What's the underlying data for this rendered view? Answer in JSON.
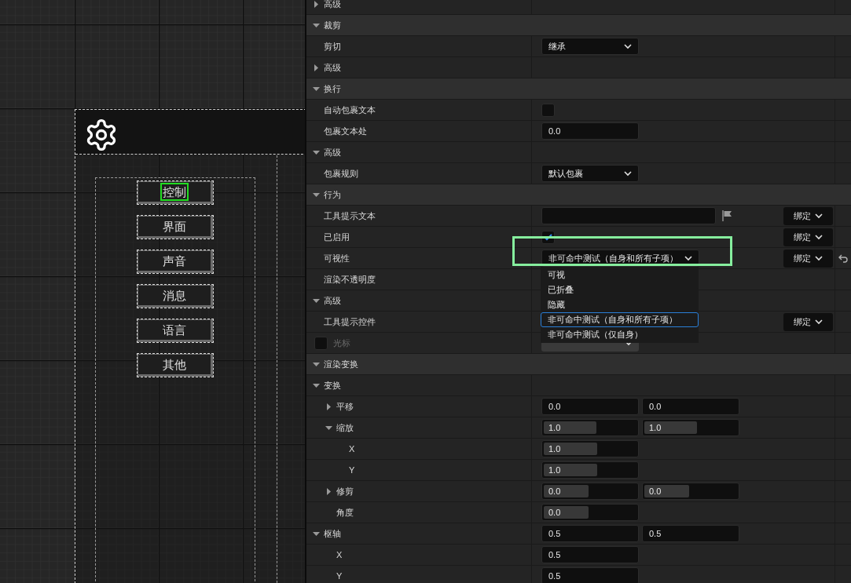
{
  "canvas": {
    "buttons": [
      {
        "label": "控制",
        "selected": true
      },
      {
        "label": "界面",
        "selected": false
      },
      {
        "label": "声音",
        "selected": false
      },
      {
        "label": "消息",
        "selected": false
      },
      {
        "label": "语言",
        "selected": false
      },
      {
        "label": "其他",
        "selected": false
      }
    ]
  },
  "details": [
    {
      "kind": "advanced",
      "label": "高级",
      "expanded": false
    },
    {
      "kind": "category",
      "label": "裁剪",
      "expanded": true,
      "children": [
        {
          "kind": "property",
          "label": "剪切",
          "value": {
            "kind": "dropdown",
            "text": "继承"
          }
        },
        {
          "kind": "advanced",
          "label": "高级",
          "expanded": false
        }
      ]
    },
    {
      "kind": "category",
      "label": "换行",
      "expanded": true,
      "children": [
        {
          "kind": "property",
          "label": "自动包裹文本",
          "value": {
            "kind": "checkbox",
            "checked": false
          }
        },
        {
          "kind": "property",
          "label": "包裹文本处",
          "value": {
            "kind": "number",
            "text": "0.0"
          }
        },
        {
          "kind": "advanced",
          "label": "高级",
          "expanded": true,
          "children": [
            {
              "kind": "property",
              "label": "包裹规则",
              "value": {
                "kind": "dropdown",
                "text": "默认包裹"
              }
            }
          ]
        }
      ]
    },
    {
      "kind": "category",
      "label": "行为",
      "expanded": true,
      "children": [
        {
          "kind": "property",
          "label": "工具提示文本",
          "value": {
            "kind": "text"
          },
          "binding": "绑定"
        },
        {
          "kind": "property",
          "label": "已启用",
          "value": {
            "kind": "checkbox",
            "checked": true
          },
          "binding": "绑定"
        },
        {
          "kind": "property",
          "label": "可视性",
          "value": {
            "kind": "dropdown",
            "text": "非可命中测试（自身和所有子项）",
            "open": true,
            "options": [
              {
                "label": "可视",
                "selected": false
              },
              {
                "label": "已折叠",
                "selected": false
              },
              {
                "label": "隐藏",
                "selected": false
              },
              {
                "label": "非可命中测试（自身和所有子项）",
                "selected": true
              },
              {
                "label": "非可命中测试（仅自身）",
                "selected": false
              }
            ]
          },
          "binding": "绑定",
          "reset": true
        },
        {
          "kind": "property",
          "label": "渲染不透明度"
        },
        {
          "kind": "advanced",
          "label": "高级",
          "expanded": true,
          "children": [
            {
              "kind": "property",
              "label": "工具提示控件",
              "binding": "绑定"
            },
            {
              "kind": "property",
              "label": "光标",
              "disabled": true,
              "edit_condition": {
                "checked": false
              },
              "value": {
                "kind": "dropdown"
              }
            }
          ]
        }
      ]
    },
    {
      "kind": "category",
      "label": "渲染变换",
      "expanded": true,
      "children": [
        {
          "kind": "group",
          "label": "变换",
          "expanded": true,
          "children": [
            {
              "kind": "group",
              "label": "平移",
              "expanded": false,
              "value": {
                "kind": "pair",
                "fields": [
                  {
                    "text": "0.0"
                  },
                  {
                    "text": "0.0"
                  }
                ]
              }
            },
            {
              "kind": "group",
              "label": "缩放",
              "expanded": true,
              "value": {
                "kind": "slider-pair",
                "fields": [
                  {
                    "text": "1.0",
                    "level": 0.57
                  },
                  {
                    "text": "1.0",
                    "level": 0.57
                  }
                ]
              },
              "children": [
                {
                  "kind": "property",
                  "label": "X",
                  "value": {
                    "kind": "slider",
                    "text": "1.0",
                    "level": 0.58
                  }
                },
                {
                  "kind": "property",
                  "label": "Y",
                  "value": {
                    "kind": "slider",
                    "text": "1.0",
                    "level": 0.58
                  }
                }
              ]
            },
            {
              "kind": "group",
              "label": "修剪",
              "expanded": false,
              "value": {
                "kind": "slider-pair",
                "fields": [
                  {
                    "text": "0.0",
                    "level": 0.48
                  },
                  {
                    "text": "0.0",
                    "level": 0.48
                  }
                ]
              }
            },
            {
              "kind": "property",
              "label": "角度",
              "value": {
                "kind": "slider",
                "text": "0.0",
                "level": 0.48
              }
            }
          ]
        },
        {
          "kind": "group",
          "label": "枢轴",
          "expanded": true,
          "value": {
            "kind": "pair",
            "fields": [
              {
                "text": "0.5"
              },
              {
                "text": "0.5"
              }
            ]
          },
          "children": [
            {
              "kind": "property",
              "label": "X",
              "value": {
                "kind": "number",
                "text": "0.5"
              }
            },
            {
              "kind": "property",
              "label": "Y",
              "value": {
                "kind": "number",
                "text": "0.5"
              }
            }
          ]
        }
      ]
    }
  ]
}
